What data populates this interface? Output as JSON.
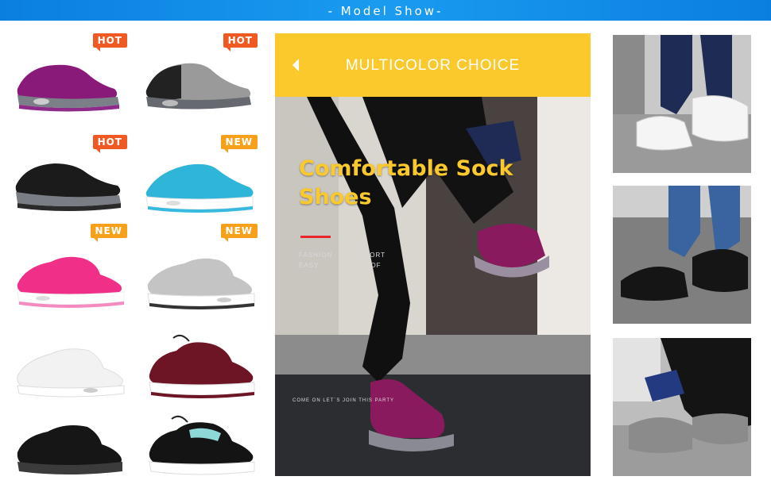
{
  "header": {
    "title": "- Model Show-"
  },
  "colors": {
    "bar": "#1a8fe8",
    "accent": "#fbc92c",
    "hot": "#f05a22",
    "new": "#f7a11a"
  },
  "products": [
    {
      "badge": "HOT",
      "color": "purple"
    },
    {
      "badge": "HOT",
      "color": "gray"
    },
    {
      "badge": "HOT",
      "color": "black"
    },
    {
      "badge": "NEW",
      "color": "blue"
    },
    {
      "badge": "NEW",
      "color": "pink"
    },
    {
      "badge": "NEW",
      "color": "light-gray"
    },
    {
      "badge": "",
      "color": "white"
    },
    {
      "badge": "",
      "color": "burgundy"
    },
    {
      "badge": "",
      "color": "black"
    },
    {
      "badge": "",
      "color": "black-mint"
    }
  ],
  "banner": {
    "title": "MULTICOLOR CHOICE",
    "headline_line1": "Comfortable Sock",
    "headline_line2": "Shoes",
    "sub_line1": "FASHION",
    "sub_line1b": "FORT",
    "sub_line2": "EASY",
    "sub_line2b": "OF",
    "footer": "COME ON LET`S JOIN THIS PARTY"
  }
}
